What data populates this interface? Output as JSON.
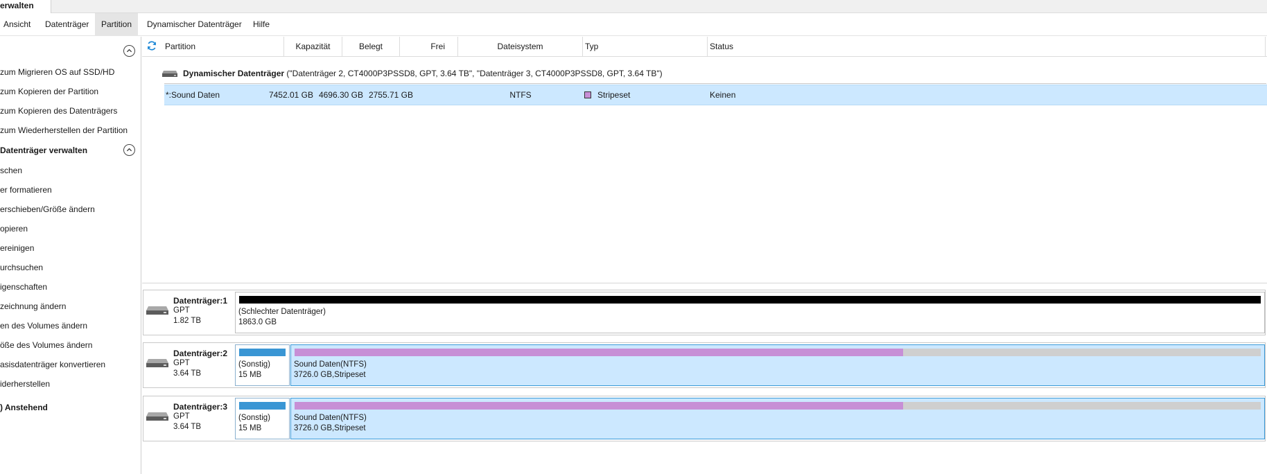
{
  "window": {
    "title": "erwalten"
  },
  "menu": {
    "items": [
      {
        "label": "Ansicht"
      },
      {
        "label": "Datenträger"
      },
      {
        "label": "Partition"
      },
      {
        "label": "Dynamischer Datenträger"
      },
      {
        "label": "Hilfe"
      }
    ],
    "active": "Partition"
  },
  "sidebar": {
    "wizards": [
      {
        "label": "zum Migrieren OS auf SSD/HD"
      },
      {
        "label": "zum Kopieren der Partition"
      },
      {
        "label": "zum Kopieren des Datenträgers"
      },
      {
        "label": "zum Wiederherstellen der Partition"
      }
    ],
    "manage_heading": "Datenträger verwalten",
    "manage_items": [
      {
        "label": "schen"
      },
      {
        "label": "er formatieren"
      },
      {
        "label": "erschieben/Größe ändern"
      },
      {
        "label": "opieren"
      },
      {
        "label": "ereinigen"
      },
      {
        "label": "urchsuchen"
      },
      {
        "label": "igenschaften"
      },
      {
        "label": "zeichnung ändern"
      },
      {
        "label": "en des Volumes ändern"
      },
      {
        "label": "öße des Volumes ändern"
      },
      {
        "label": "asisdatenträger konvertieren"
      },
      {
        "label": "iderherstellen"
      }
    ],
    "pending_heading": ") Anstehend"
  },
  "partition_table": {
    "columns": [
      {
        "label": "Partition"
      },
      {
        "label": "Kapazität"
      },
      {
        "label": "Belegt"
      },
      {
        "label": "Frei"
      },
      {
        "label": "Dateisystem"
      },
      {
        "label": "Typ"
      },
      {
        "label": "Status"
      }
    ],
    "group": {
      "title": "Dynamischer Datenträger",
      "detail": "(\"Datenträger 2, CT4000P3PSSD8, GPT, 3.64 TB\", \"Datenträger 3, CT4000P3PSSD8, GPT, 3.64 TB\")"
    },
    "rows": [
      {
        "partition": "*:Sound Daten",
        "capacity": "7452.01 GB",
        "used": "4696.30 GB",
        "free": "2755.71 GB",
        "filesystem": "NTFS",
        "type": "Stripeset",
        "type_color": "#c78fd6",
        "status": "Keinen"
      }
    ]
  },
  "disks": [
    {
      "name": "Datenträger:1",
      "style": "GPT",
      "size": "1.82 TB",
      "segments": [
        {
          "line1": "(Schlechter Datenträger)",
          "line2": "1863.0 GB",
          "fill_color": "#000000",
          "fill_fraction": 1.0,
          "selected": false
        }
      ]
    },
    {
      "name": "Datenträger:2",
      "style": "GPT",
      "size": "3.64 TB",
      "segments": [
        {
          "line1": "(Sonstig)",
          "line2": "15 MB",
          "fill_color": "#3a96d4",
          "fill_fraction": 1.0,
          "selected": false
        },
        {
          "line1": "Sound Daten(NTFS)",
          "line2": "3726.0 GB,Stripeset",
          "fill_color": "#c78fd6",
          "fill_fraction": 0.63,
          "selected": true
        }
      ]
    },
    {
      "name": "Datenträger:3",
      "style": "GPT",
      "size": "3.64 TB",
      "segments": [
        {
          "line1": "(Sonstig)",
          "line2": "15 MB",
          "fill_color": "#3a96d4",
          "fill_fraction": 1.0,
          "selected": false
        },
        {
          "line1": "Sound Daten(NTFS)",
          "line2": "3726.0 GB,Stripeset",
          "fill_color": "#c78fd6",
          "fill_fraction": 0.63,
          "selected": true
        }
      ]
    }
  ],
  "icons": {
    "refresh": "refresh-icon",
    "collapse": "chevron-up-circle-icon",
    "disk": "hard-disk-icon"
  },
  "colors": {
    "selection": "#cce8ff",
    "stripeset": "#c78fd6",
    "other_partition": "#3a96d4",
    "bad_disk": "#000000",
    "unused_bar": "#cfcfcf"
  }
}
